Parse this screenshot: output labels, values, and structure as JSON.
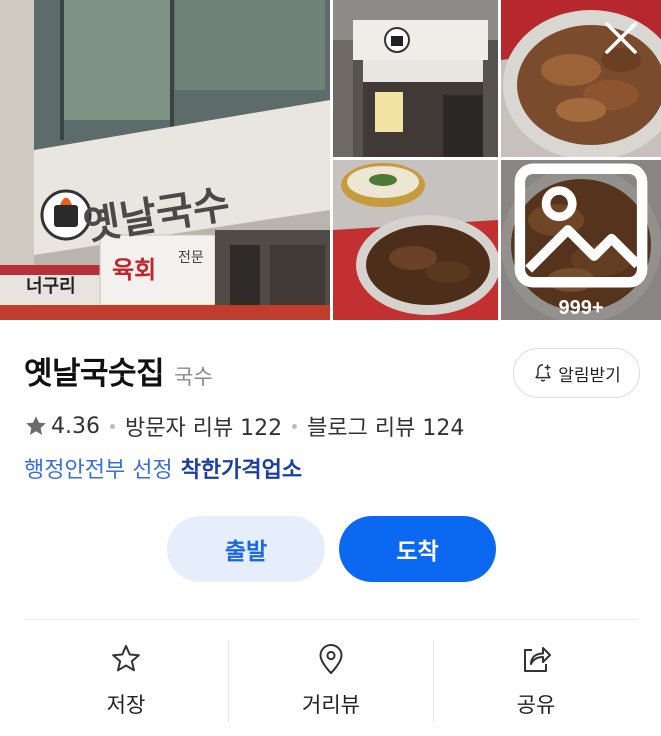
{
  "gallery": {
    "main_sign_text": "옛날국수",
    "side_sign_left": "너구리",
    "side_sign_right": "육회",
    "side_sign_small": "전문",
    "more_photos": "999+"
  },
  "place": {
    "name": "옛날국숫집",
    "category": "국수",
    "alarm_label": "알림받기"
  },
  "stats": {
    "rating": "4.36",
    "visitor_reviews": "방문자 리뷰 122",
    "blog_reviews": "블로그 리뷰 124"
  },
  "selection": {
    "agency": "행정안전부 선정",
    "badge": "착한가격업소"
  },
  "buttons": {
    "depart": "출발",
    "arrive": "도착"
  },
  "actions": {
    "save": "저장",
    "street_view": "거리뷰",
    "share": "공유"
  },
  "colors": {
    "accent": "#0b68f0",
    "accent_light": "#e6eefb",
    "selection_blue": "#3a6fd8",
    "badge_navy": "#1d3f9c"
  }
}
